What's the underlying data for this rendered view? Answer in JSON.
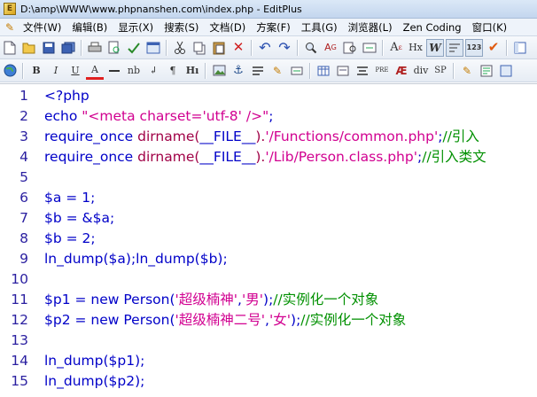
{
  "window": {
    "title": "D:\\amp\\WWW\\www.phpnanshen.com\\index.php - EditPlus"
  },
  "menu": {
    "items": [
      {
        "id": "file",
        "label": "文件(W)"
      },
      {
        "id": "edit",
        "label": "编辑(B)"
      },
      {
        "id": "view",
        "label": "显示(X)"
      },
      {
        "id": "search",
        "label": "搜索(S)"
      },
      {
        "id": "document",
        "label": "文档(D)"
      },
      {
        "id": "project",
        "label": "方案(F)"
      },
      {
        "id": "tools",
        "label": "工具(G)"
      },
      {
        "id": "browser",
        "label": "浏览器(L)"
      },
      {
        "id": "zencoding",
        "label": "Zen Coding"
      },
      {
        "id": "window",
        "label": "窗口(K)"
      }
    ]
  },
  "toolbar2_labels": {
    "bold": "B",
    "italic": "I",
    "underline": "U",
    "font_color": "A",
    "nbsp": "nb",
    "para": "¶",
    "heading": "Hı",
    "pre": "PRE",
    "div": "div",
    "span": "SP",
    "anchor": "⚓",
    "hx": "Hx",
    "w": "W"
  },
  "editor": {
    "lines": [
      {
        "n": "1",
        "tokens": [
          {
            "t": "<?php",
            "c": "kw"
          }
        ]
      },
      {
        "n": "2",
        "tokens": [
          {
            "t": "echo ",
            "c": "kw"
          },
          {
            "t": "\"<meta charset='utf-8' />\"",
            "c": "str"
          },
          {
            "t": ";",
            "c": "plain"
          }
        ]
      },
      {
        "n": "3",
        "tokens": [
          {
            "t": "require_once ",
            "c": "kw"
          },
          {
            "t": "dirname(",
            "c": "fn"
          },
          {
            "t": "__FILE__",
            "c": "kw"
          },
          {
            "t": ").",
            "c": "fn"
          },
          {
            "t": "'/Functions/common.php'",
            "c": "str"
          },
          {
            "t": ";",
            "c": "plain"
          },
          {
            "t": "//引入",
            "c": "cmt"
          }
        ]
      },
      {
        "n": "4",
        "tokens": [
          {
            "t": "require_once ",
            "c": "kw"
          },
          {
            "t": "dirname(",
            "c": "fn"
          },
          {
            "t": "__FILE__",
            "c": "kw"
          },
          {
            "t": ").",
            "c": "fn"
          },
          {
            "t": "'/Lib/Person.class.php'",
            "c": "str"
          },
          {
            "t": ";",
            "c": "plain"
          },
          {
            "t": "//引入类文",
            "c": "cmt"
          }
        ]
      },
      {
        "n": "5",
        "tokens": []
      },
      {
        "n": "6",
        "tokens": [
          {
            "t": "$a",
            "c": "var"
          },
          {
            "t": " = 1;",
            "c": "plain"
          }
        ]
      },
      {
        "n": "7",
        "tokens": [
          {
            "t": "$b",
            "c": "var"
          },
          {
            "t": " = &",
            "c": "plain"
          },
          {
            "t": "$a",
            "c": "var"
          },
          {
            "t": ";",
            "c": "plain"
          }
        ]
      },
      {
        "n": "8",
        "tokens": [
          {
            "t": "$b",
            "c": "var"
          },
          {
            "t": " = 2;",
            "c": "plain"
          }
        ]
      },
      {
        "n": "9",
        "tokens": [
          {
            "t": "ln_dump(",
            "c": "plain"
          },
          {
            "t": "$a",
            "c": "var"
          },
          {
            "t": ");ln_dump(",
            "c": "plain"
          },
          {
            "t": "$b",
            "c": "var"
          },
          {
            "t": ");",
            "c": "plain"
          }
        ]
      },
      {
        "n": "10",
        "tokens": []
      },
      {
        "n": "11",
        "tokens": [
          {
            "t": "$p1",
            "c": "var"
          },
          {
            "t": " = new Person(",
            "c": "plain"
          },
          {
            "t": "'超级楠神'",
            "c": "str"
          },
          {
            "t": ",",
            "c": "plain"
          },
          {
            "t": "'男'",
            "c": "str"
          },
          {
            "t": ");",
            "c": "plain"
          },
          {
            "t": "//实例化一个对象",
            "c": "cmt"
          }
        ]
      },
      {
        "n": "12",
        "tokens": [
          {
            "t": "$p2",
            "c": "var"
          },
          {
            "t": " = new Person(",
            "c": "plain"
          },
          {
            "t": "'超级楠神二号'",
            "c": "str"
          },
          {
            "t": ",",
            "c": "plain"
          },
          {
            "t": "'女'",
            "c": "str"
          },
          {
            "t": ");",
            "c": "plain"
          },
          {
            "t": "//实例化一个对象",
            "c": "cmt"
          }
        ]
      },
      {
        "n": "13",
        "tokens": []
      },
      {
        "n": "14",
        "tokens": [
          {
            "t": "ln_dump(",
            "c": "plain"
          },
          {
            "t": "$p1",
            "c": "var"
          },
          {
            "t": ");",
            "c": "plain"
          }
        ]
      },
      {
        "n": "15",
        "tokens": [
          {
            "t": "ln_dump(",
            "c": "plain"
          },
          {
            "t": "$p2",
            "c": "var"
          },
          {
            "t": ");",
            "c": "plain"
          }
        ]
      }
    ]
  },
  "colors": {
    "keyword": "#0000c8",
    "string": "#d10090",
    "function": "#a00046",
    "comment": "#009000",
    "line_number": "#2a1fa0"
  }
}
